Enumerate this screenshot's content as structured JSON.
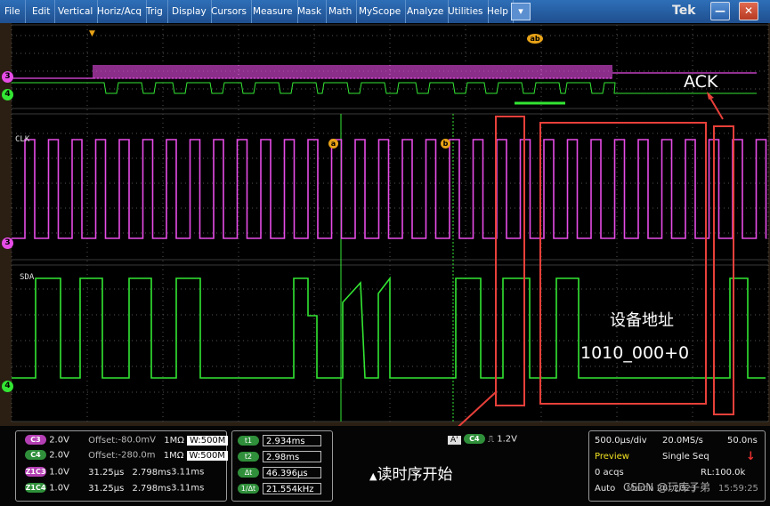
{
  "menu": {
    "items": [
      "File",
      "Edit",
      "Vertical",
      "Horiz/Acq",
      "Trig",
      "Display",
      "Cursors",
      "Measure",
      "Mask",
      "Math",
      "MyScope",
      "Analyze",
      "Utilities",
      "Help"
    ],
    "dropdown_glyph": "▾",
    "logo": "Tek",
    "minimize_glyph": "—",
    "close_glyph": "✕"
  },
  "waveform": {
    "ch3_marker": "3",
    "ch4_marker": "4",
    "clk_label": "CLK",
    "sda_label": "SDA",
    "cursor_a": "a",
    "cursor_b": "b",
    "cursor_ab": "ab",
    "ch3_color": "#e64ce6",
    "ch4_color": "#33e633",
    "grid_color": "#555555",
    "annotation_color": "#e8403a"
  },
  "annotations": {
    "ack": "ACK",
    "device_address": "设备地址",
    "address_bits": "1010_000+0",
    "read_start": "读时序开始",
    "read_start_glyph": "▲"
  },
  "channels": [
    {
      "badge": "C3",
      "color": "#b43fb4",
      "scale": "2.0V",
      "offset_label": "Offset:",
      "offset": "-80.0mV",
      "impedance": "1MΩ",
      "bw": "W:500M"
    },
    {
      "badge": "C4",
      "color": "#2f8f3a",
      "scale": "2.0V",
      "offset_label": "Offset:",
      "offset": "-280.0m",
      "impedance": "1MΩ",
      "bw": "W:500M"
    },
    {
      "badge": "Z1C3",
      "color": "#b43fb4",
      "scale": "1.0V",
      "v1": "31.25μs",
      "v2": "2.798ms",
      "v3": "3.11ms"
    },
    {
      "badge": "Z1C4",
      "color": "#2f8f3a",
      "scale": "1.0V",
      "v1": "31.25μs",
      "v2": "2.798ms",
      "v3": "3.11ms"
    }
  ],
  "cursor_readouts": [
    {
      "label": "t1",
      "value": "2.934ms"
    },
    {
      "label": "t2",
      "value": "2.98ms"
    },
    {
      "label": "Δt",
      "value": "46.396μs"
    },
    {
      "label": "1/Δt",
      "value": "21.554kHz"
    }
  ],
  "trigger": {
    "mode_badge": "A'",
    "source_badge": "C4",
    "slope_glyph": "⎍",
    "level": "1.2V"
  },
  "acquisition": {
    "timebase": "500.0μs/div",
    "sample_rate": "20.0MS/s",
    "resolution": "50.0ns",
    "mode": "Preview",
    "run_mode": "Single Seq",
    "acqs": "0 acqs",
    "record_length": "RL:100.0k",
    "trigger_mode": "Auto",
    "date_partial": "March 26, 2023",
    "time_partial": "15:59:25",
    "status_glyph": "↓"
  },
  "watermark": "CSDN @玩库子弟"
}
